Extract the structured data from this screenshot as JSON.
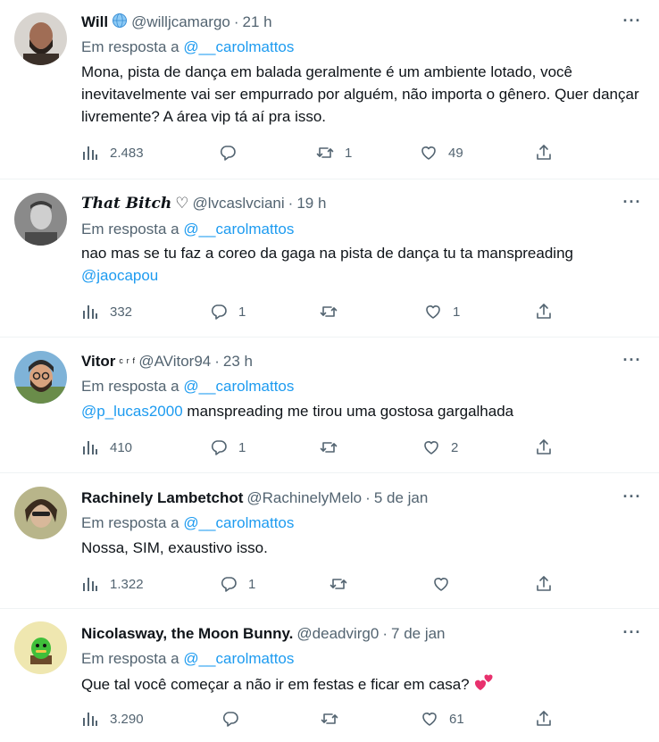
{
  "tweets": [
    {
      "name": "Will",
      "handle": "@willjcamargo",
      "sep": "·",
      "time": "21 h",
      "reply_prefix": "Em resposta a",
      "reply_to": "@__carolmattos",
      "text": "Mona, pista de dança em balada geralmente é um ambiente lotado, você inevitavelmente vai ser empurrado por alguém, não importa o gênero. Quer dançar livremente? A área vip tá aí pra isso.",
      "views": "2.483",
      "replies": "",
      "retweets": "1",
      "likes": "49"
    },
    {
      "name": "𝑻𝒉𝒂𝒕 𝑩𝒊𝒕𝒄𝒉",
      "name_suffix": "♡",
      "handle": "@lvcaslvciani",
      "sep": "·",
      "time": "19 h",
      "reply_prefix": "Em resposta a",
      "reply_to": "@__carolmattos",
      "text": "nao mas se tu faz a coreo da gaga na pista de dança tu ta manspreading",
      "mention": "@jaocapou",
      "views": "332",
      "replies": "1",
      "retweets": "",
      "likes": "1"
    },
    {
      "name": "Vitor",
      "name_suffix": "ᶜ ʳ ᶠ",
      "handle": "@AVitor94",
      "sep": "·",
      "time": "23 h",
      "reply_prefix": "Em resposta a",
      "reply_to": "@__carolmattos",
      "mention": "@p_lucas2000",
      "text": "manspreading me tirou uma gostosa gargalhada",
      "views": "410",
      "replies": "1",
      "retweets": "",
      "likes": "2"
    },
    {
      "name": "Rachinely Lambetchot",
      "handle": "@RachinelyMelo",
      "sep": "·",
      "time": "5 de jan",
      "reply_prefix": "Em resposta a",
      "reply_to": "@__carolmattos",
      "text": "Nossa, SIM, exaustivo isso.",
      "views": "1.322",
      "replies": "1",
      "retweets": "",
      "likes": ""
    },
    {
      "name": "Nicolasway, the Moon Bunny.",
      "handle": "@deadvirg0",
      "sep": "·",
      "time": "7 de jan",
      "reply_prefix": "Em resposta a",
      "reply_to": "@__carolmattos",
      "text": "Que tal você começar a não ir em festas e ficar em casa?",
      "views": "3.290",
      "replies": "",
      "retweets": "",
      "likes": "61"
    }
  ],
  "icons": {
    "more": "more-icon",
    "views": "views-icon",
    "reply": "reply-icon",
    "retweet": "retweet-icon",
    "like": "like-icon",
    "share": "share-icon"
  },
  "colors": {
    "link": "#1d9bf0",
    "secondary": "#536471",
    "text": "#0f1419",
    "divider": "#eff3f4"
  }
}
